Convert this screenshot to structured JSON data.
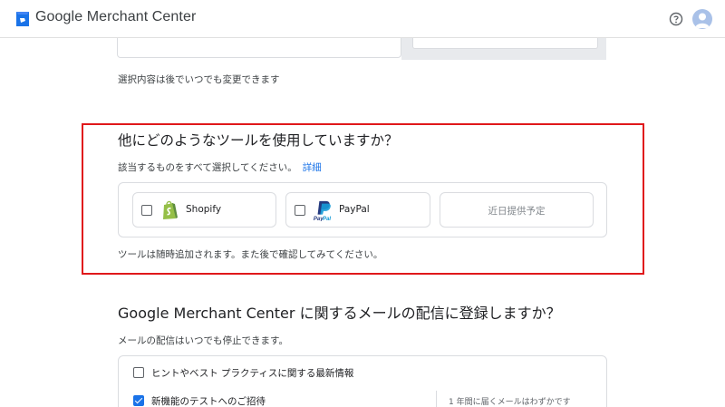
{
  "header": {
    "app_title": "Google Merchant Center",
    "help_icon": "help-circle-icon",
    "avatar_icon": "account-avatar-icon"
  },
  "previous_section": {
    "note": "選択内容は後でいつでも変更できます"
  },
  "tools_section": {
    "title": "他にどのようなツールを使用していますか？",
    "subtitle": "該当するものをすべて選択してください。",
    "link": "詳細",
    "options": [
      {
        "label": "Shopify",
        "checked": false,
        "icon": "shopify-icon"
      },
      {
        "label": "PayPal",
        "checked": false,
        "icon": "paypal-icon"
      },
      {
        "label": "近日提供予定",
        "disabled": true
      }
    ],
    "note": "ツールは随時追加されます。また後で確認してみてください。"
  },
  "mail_section": {
    "title": "Google Merchant Center に関するメールの配信に登録しますか？",
    "subtitle": "メールの配信はいつでも停止できます。",
    "options": [
      {
        "label": "ヒントやベスト プラクティスに関する最新情報",
        "checked": false
      },
      {
        "label": "新機能のテストへのご招待",
        "checked": true
      }
    ],
    "frequency_note": "1 年間に届くメールはわずかです"
  },
  "colors": {
    "highlight": "#e0181b",
    "link": "#1a73e8",
    "checkbox_checked": "#1a73e8"
  }
}
